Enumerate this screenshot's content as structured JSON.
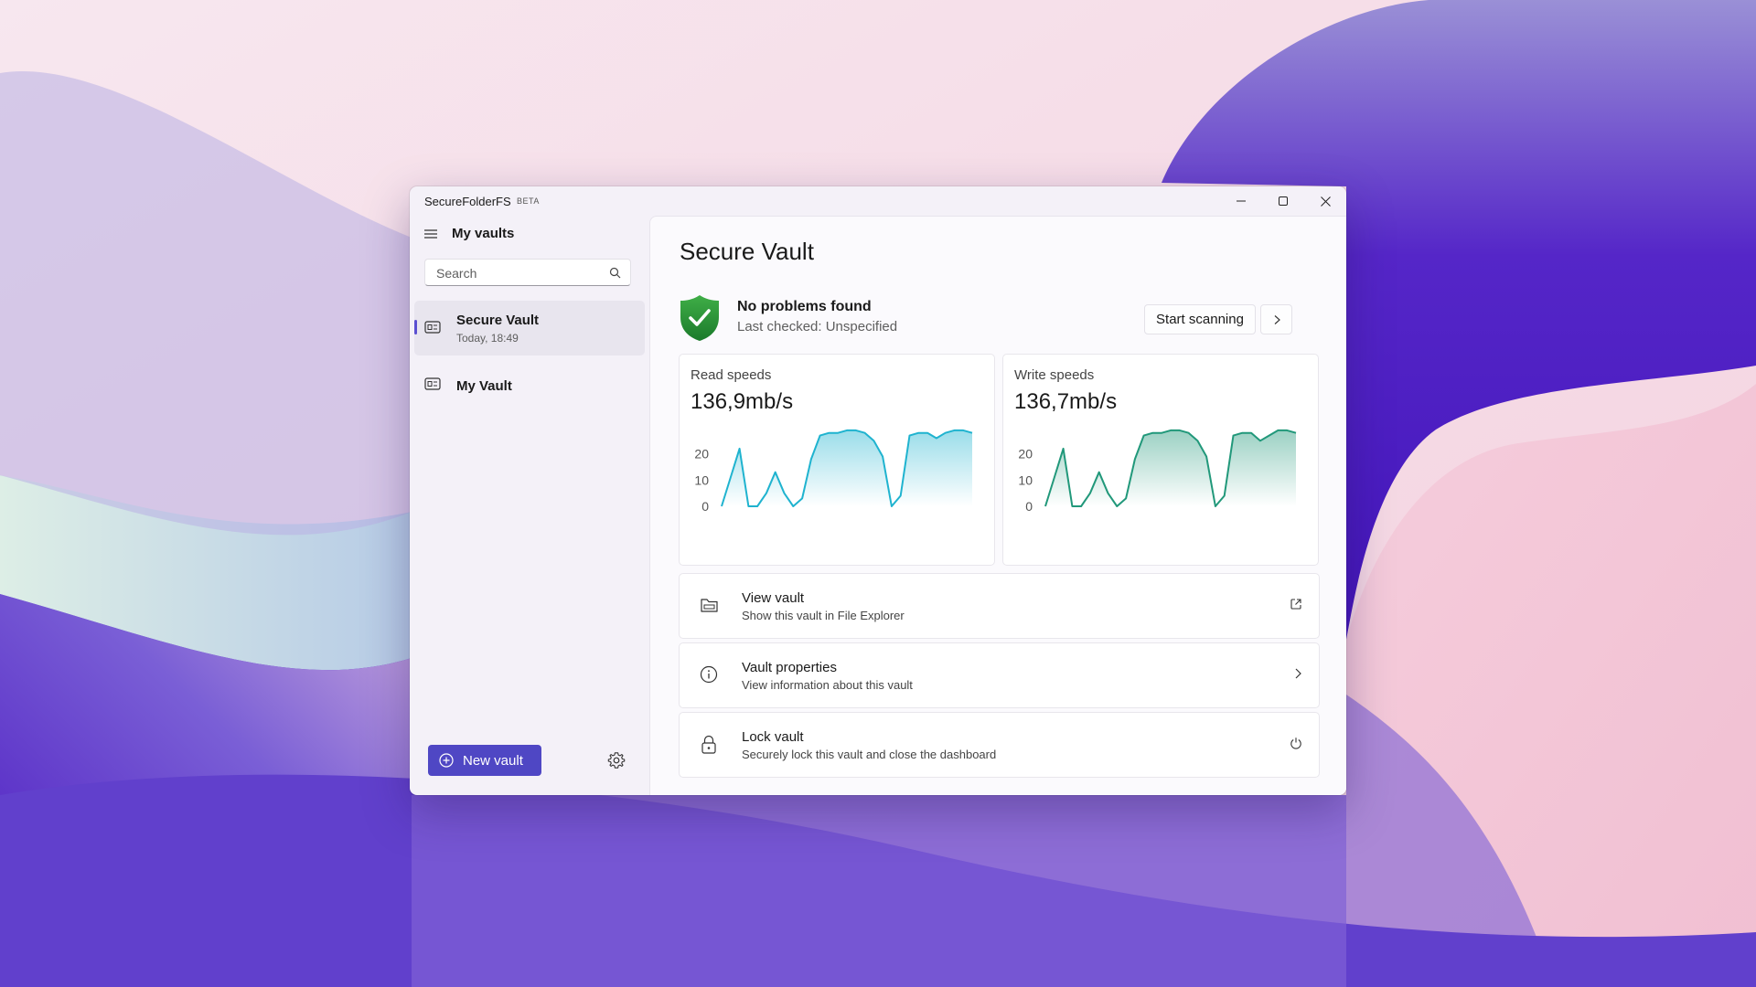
{
  "window": {
    "app_title": "SecureFolderFS",
    "app_badge": "BETA"
  },
  "sidebar": {
    "header": "My vaults",
    "search_placeholder": "Search",
    "vaults": [
      {
        "name": "Secure Vault",
        "subtitle": "Today, 18:49",
        "selected": true
      },
      {
        "name": "My Vault",
        "subtitle": "",
        "selected": false
      }
    ],
    "new_vault_label": "New vault"
  },
  "main": {
    "title": "Secure Vault",
    "health": {
      "status": "No problems found",
      "last_checked": "Last checked: Unspecified",
      "scan_button": "Start scanning"
    },
    "graphs": {
      "read": {
        "label": "Read speeds",
        "value": "136,9mb/s"
      },
      "write": {
        "label": "Write speeds",
        "value": "136,7mb/s"
      }
    },
    "actions": [
      {
        "title": "View vault",
        "subtitle": "Show this vault in File Explorer"
      },
      {
        "title": "Vault properties",
        "subtitle": "View information about this vault"
      },
      {
        "title": "Lock vault",
        "subtitle": "Securely lock this vault and close the dashboard"
      }
    ]
  },
  "chart_data": [
    {
      "type": "area",
      "title": "Read speeds",
      "y_ticks": [
        "20",
        "10",
        "0"
      ],
      "ylim": [
        0,
        30
      ],
      "values": [
        0,
        11,
        22,
        0,
        0,
        5,
        13,
        5,
        0,
        3,
        18,
        27,
        28,
        28,
        29,
        29,
        28,
        25,
        19,
        0,
        4,
        27,
        28,
        28,
        26,
        28,
        29,
        29,
        28
      ],
      "color": "#1fb3cf"
    },
    {
      "type": "area",
      "title": "Write speeds",
      "y_ticks": [
        "20",
        "10",
        "0"
      ],
      "ylim": [
        0,
        30
      ],
      "values": [
        0,
        11,
        22,
        0,
        0,
        5,
        13,
        5,
        0,
        3,
        18,
        27,
        28,
        28,
        29,
        29,
        28,
        25,
        19,
        0,
        4,
        27,
        28,
        28,
        25,
        27,
        29,
        29,
        28
      ],
      "color": "#21987a"
    }
  ]
}
